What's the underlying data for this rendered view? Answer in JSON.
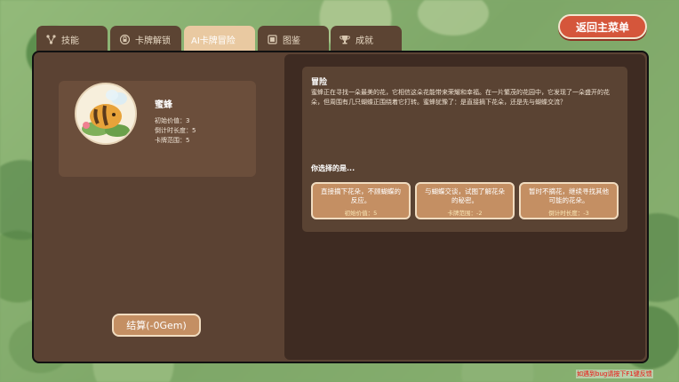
{
  "header": {
    "main_menu_label": "返回主菜单"
  },
  "tabs": [
    {
      "label": "技能",
      "icon": "skill-tree-icon",
      "active": false
    },
    {
      "label": "卡牌解锁",
      "icon": "lock-icon",
      "active": false
    },
    {
      "label": "AI卡牌冒险",
      "icon": "",
      "active": true
    },
    {
      "label": "图鉴",
      "icon": "book-icon",
      "active": false
    },
    {
      "label": "成就",
      "icon": "trophy-icon",
      "active": false
    }
  ],
  "card": {
    "name": "蜜蜂",
    "icon": "bee-icon",
    "stats": [
      {
        "label": "初始价值：",
        "value": "3"
      },
      {
        "label": "倒计时长度：",
        "value": "5"
      },
      {
        "label": "卡牌范围：",
        "value": "5"
      }
    ]
  },
  "adventure": {
    "title": "冒险",
    "text": "蜜蜂正在寻找一朵最美的花，它相信这朵花能带来荣耀和幸福。在一片繁茂的花园中，它发现了一朵盛开的花朵，但周围有几只蝴蝶正围绕着它打转。蜜蜂犹豫了：是直接摘下花朵，还是先与蝴蝶交流？",
    "choose_label": "你选择的是...",
    "choices": [
      {
        "text": "直接摘下花朵，不顾蝴蝶的反应。",
        "effect": "初始价值：5"
      },
      {
        "text": "与蝴蝶交谈，试图了解花朵的秘密。",
        "effect": "卡牌范围：-2"
      },
      {
        "text": "暂时不摘花，继续寻找其他可能的花朵。",
        "effect": "倒计时长度：-3"
      }
    ]
  },
  "settle_label": "结算(-0Gem)",
  "bug_note": "如遇到bug请按下F1键反馈"
}
